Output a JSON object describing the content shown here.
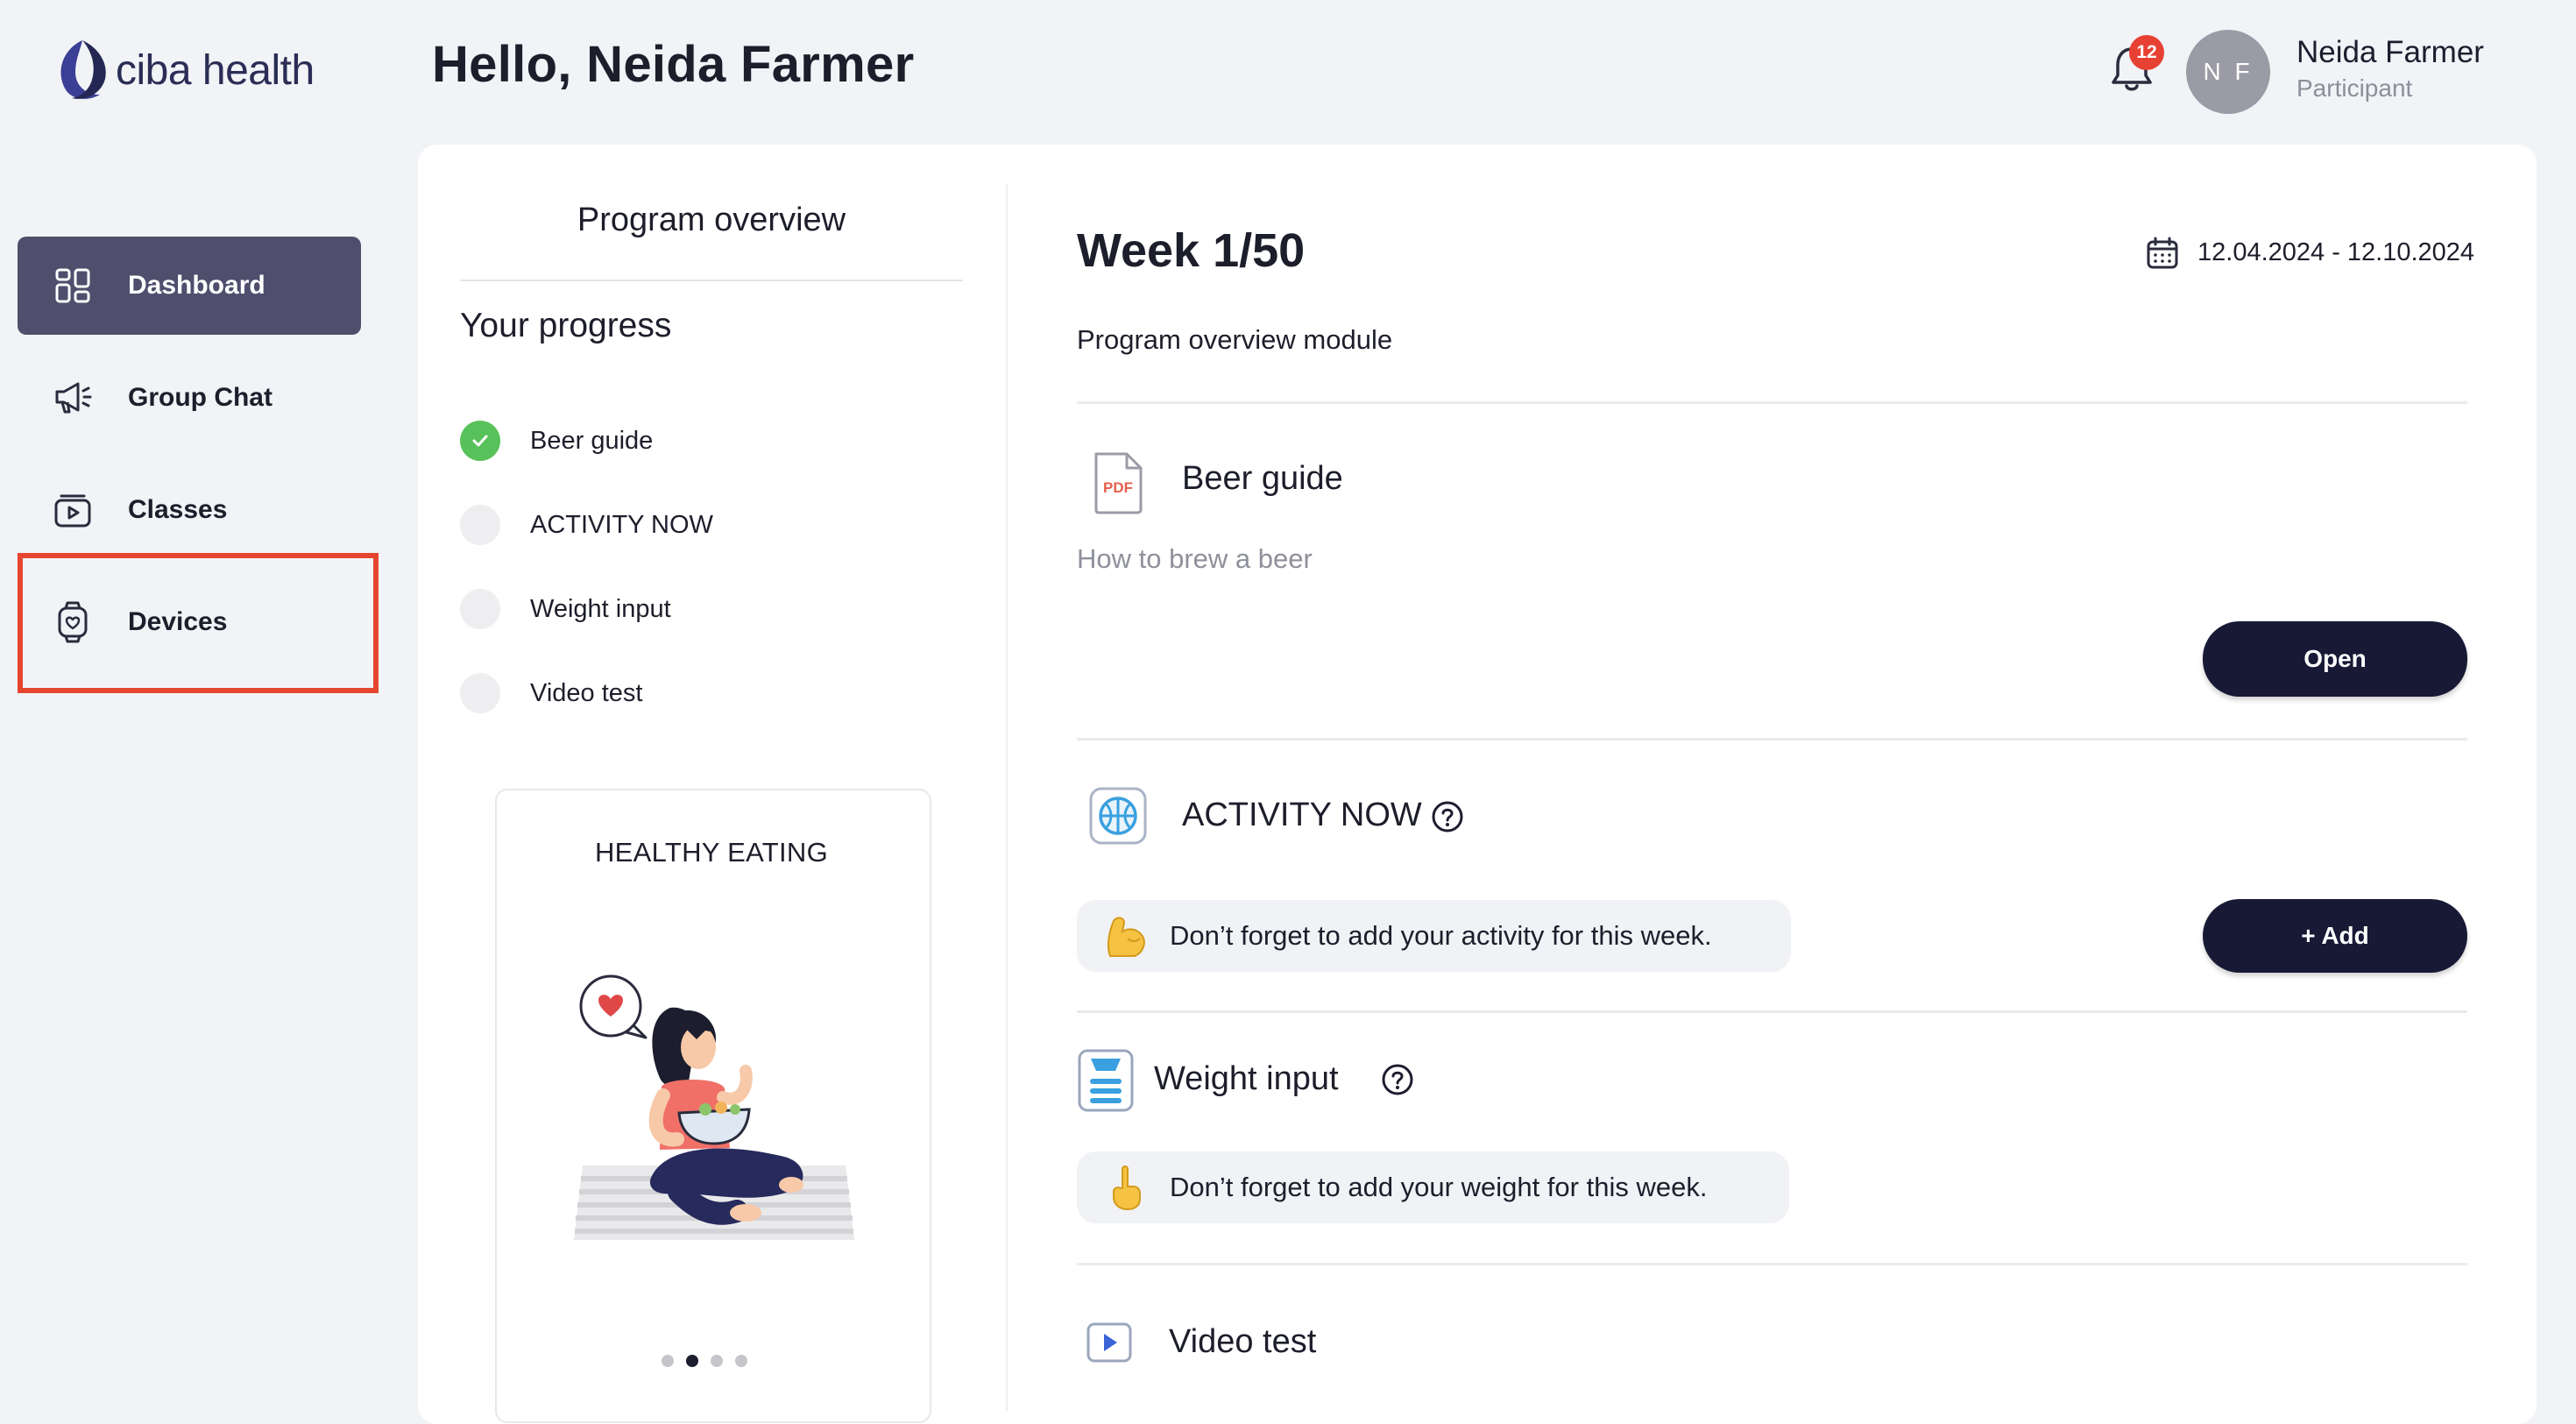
{
  "brand": {
    "name": "ciba health"
  },
  "header": {
    "greeting": "Hello, Neida Farmer",
    "notification_count": "12",
    "user_initials": "N F",
    "user_name": "Neida Farmer",
    "user_role": "Participant"
  },
  "sidebar": {
    "items": [
      {
        "label": "Dashboard",
        "icon": "dashboard-icon",
        "active": true
      },
      {
        "label": "Group Chat",
        "icon": "megaphone-icon"
      },
      {
        "label": "Classes",
        "icon": "play-box-icon"
      },
      {
        "label": "Devices",
        "icon": "watch-icon"
      }
    ],
    "highlight_color": "#e5452f"
  },
  "overview": {
    "title": "Program overview",
    "progress_title": "Your progress",
    "progress_items": [
      {
        "label": "Beer guide",
        "done": true
      },
      {
        "label": "ACTIVITY NOW",
        "done": false
      },
      {
        "label": "Weight input",
        "done": false
      },
      {
        "label": "Video test",
        "done": false
      }
    ],
    "tip_card": {
      "title": "HEALTHY EATING",
      "slide_count": 4,
      "active_slide": 2
    }
  },
  "week": {
    "title": "Week 1/50",
    "date_range": "12.04.2024  -  12.10.2024",
    "module_name": "Program overview module",
    "beer_guide": {
      "title": "Beer guide",
      "subtitle": "How to brew a beer",
      "icon_text": "PDF",
      "button_label": "Open"
    },
    "activity": {
      "title": "ACTIVITY NOW",
      "reminder": "Don’t forget to add your activity for this week.",
      "button_label": "+ Add"
    },
    "weight": {
      "title": "Weight input",
      "reminder": "Don’t forget to add your weight for this week."
    },
    "video": {
      "title": "Video test"
    }
  },
  "colors": {
    "accent": "#171935",
    "sidebar_active": "#4f4e6d",
    "success": "#57c15a",
    "badge": "#e74133"
  }
}
